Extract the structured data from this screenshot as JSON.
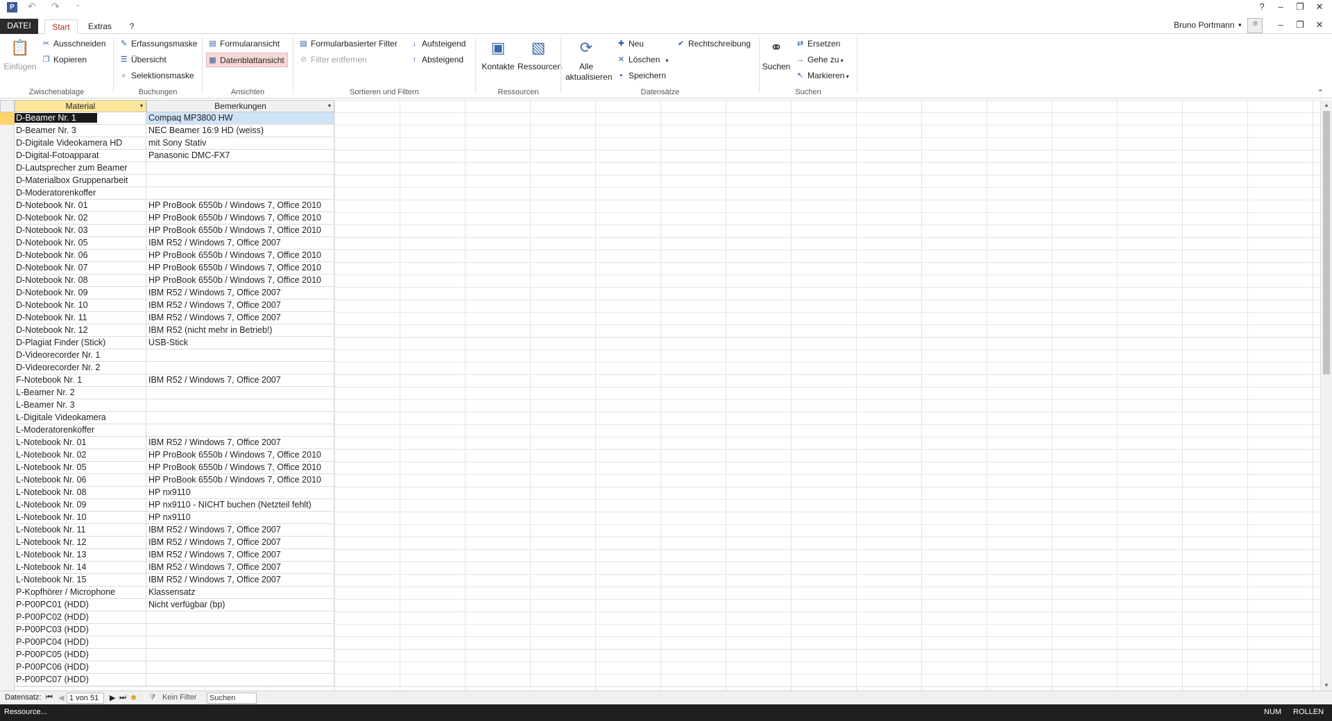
{
  "titlebar": {
    "undo": "↶",
    "redo": "↷",
    "more": "⌄",
    "help": "?",
    "min": "–",
    "restore": "❐",
    "close": "✕"
  },
  "tabs": {
    "file": "DATEI",
    "start": "Start",
    "extras": "Extras",
    "help": "?"
  },
  "user": {
    "name": "Bruno Portmann",
    "dropdown": "▾",
    "win_min": "–",
    "win_restore": "❐",
    "win_close": "✕"
  },
  "ribbon": {
    "clipboard": {
      "label": "Zwischenablage",
      "paste": "Einfügen",
      "cut": "Ausschneiden",
      "copy": "Kopieren"
    },
    "bookings": {
      "label": "Buchungen",
      "capture_mask": "Erfassungsmaske",
      "overview": "Übersicht",
      "selection_mask": "Selektionsmaske"
    },
    "views": {
      "label": "Ansichten",
      "form_view": "Formularansicht",
      "datasheet_view": "Datenblattansicht"
    },
    "sort_filter": {
      "label": "Sortieren und Filtern",
      "form_filter": "Formularbasierter Filter",
      "remove_filter": "Filter entfernen",
      "ascending": "Aufsteigend",
      "descending": "Absteigend"
    },
    "resources": {
      "label": "Ressourcen",
      "contacts": "Kontakte",
      "resources": "Ressourcen"
    },
    "records": {
      "label": "Datensätze",
      "refresh_all_1": "Alle",
      "refresh_all_2": "aktualisieren",
      "new": "Neu",
      "delete": "Löschen",
      "save": "Speichern",
      "spelling": "Rechtschreibung"
    },
    "find": {
      "label": "Suchen",
      "find": "Suchen",
      "replace": "Ersetzen",
      "goto": "Gehe zu",
      "select": "Markieren"
    }
  },
  "table": {
    "columns": [
      "Material",
      "Bemerkungen"
    ],
    "rows": [
      [
        "D-Beamer Nr. 1",
        "Compaq MP3800 HW"
      ],
      [
        "D-Beamer Nr. 3",
        "NEC Beamer 16:9 HD (weiss)"
      ],
      [
        "D-Digitale Videokamera HD",
        "mit Sony Stativ"
      ],
      [
        "D-Digital-Fotoapparat",
        "Panasonic DMC-FX7"
      ],
      [
        "D-Lautsprecher zum Beamer",
        ""
      ],
      [
        "D-Materialbox Gruppenarbeit",
        ""
      ],
      [
        "D-Moderatorenkoffer",
        ""
      ],
      [
        "D-Notebook Nr. 01",
        "HP ProBook 6550b / Windows 7, Office 2010"
      ],
      [
        "D-Notebook Nr. 02",
        "HP ProBook 6550b / Windows 7, Office 2010"
      ],
      [
        "D-Notebook Nr. 03",
        "HP ProBook 6550b / Windows 7, Office 2010"
      ],
      [
        "D-Notebook Nr. 05",
        "IBM R52 / Windows 7, Office 2007"
      ],
      [
        "D-Notebook Nr. 06",
        "HP ProBook 6550b / Windows 7, Office 2010"
      ],
      [
        "D-Notebook Nr. 07",
        "HP ProBook 6550b / Windows 7, Office 2010"
      ],
      [
        "D-Notebook Nr. 08",
        "HP ProBook 6550b / Windows 7, Office 2010"
      ],
      [
        "D-Notebook Nr. 09",
        "IBM R52 / Windows 7, Office 2007"
      ],
      [
        "D-Notebook Nr. 10",
        "IBM R52 / Windows 7, Office 2007"
      ],
      [
        "D-Notebook Nr. 11",
        "IBM R52 / Windows 7, Office 2007"
      ],
      [
        "D-Notebook Nr. 12",
        "IBM R52 (nicht mehr in Betrieb!)"
      ],
      [
        "D-Plagiat Finder (Stick)",
        "USB-Stick"
      ],
      [
        "D-Videorecorder Nr. 1",
        ""
      ],
      [
        "D-Videorecorder Nr. 2",
        ""
      ],
      [
        "F-Notebook Nr. 1",
        "IBM R52 / Windows 7, Office 2007"
      ],
      [
        "L-Beamer Nr. 2",
        ""
      ],
      [
        "L-Beamer Nr. 3",
        ""
      ],
      [
        "L-Digitale Videokamera",
        ""
      ],
      [
        "L-Moderatorenkoffer",
        ""
      ],
      [
        "L-Notebook Nr. 01",
        "IBM R52 / Windows 7, Office 2007"
      ],
      [
        "L-Notebook Nr. 02",
        "HP ProBook 6550b / Windows 7, Office 2010"
      ],
      [
        "L-Notebook Nr. 05",
        "HP ProBook 6550b / Windows 7, Office 2010"
      ],
      [
        "L-Notebook Nr. 06",
        "HP ProBook 6550b / Windows 7, Office 2010"
      ],
      [
        "L-Notebook Nr. 08",
        "HP nx9110"
      ],
      [
        "L-Notebook Nr. 09",
        "HP nx9110 - NICHT buchen (Netzteil fehlt)"
      ],
      [
        "L-Notebook Nr. 10",
        "HP nx9110"
      ],
      [
        "L-Notebook Nr. 11",
        "IBM R52 / Windows 7, Office 2007"
      ],
      [
        "L-Notebook Nr. 12",
        "IBM R52 / Windows 7, Office 2007"
      ],
      [
        "L-Notebook Nr. 13",
        "IBM R52 / Windows 7, Office 2007"
      ],
      [
        "L-Notebook Nr. 14",
        "IBM R52 / Windows 7, Office 2007"
      ],
      [
        "L-Notebook Nr. 15",
        "IBM R52 / Windows 7, Office 2007"
      ],
      [
        "P-Kopfhörer / Microphone",
        "Klassensatz"
      ],
      [
        "P-P00PC01 (HDD)",
        "Nicht verfügbar (bp)"
      ],
      [
        "P-P00PC02 (HDD)",
        ""
      ],
      [
        "P-P00PC03 (HDD)",
        ""
      ],
      [
        "P-P00PC04 (HDD)",
        ""
      ],
      [
        "P-P00PC05 (HDD)",
        ""
      ],
      [
        "P-P00PC06 (HDD)",
        ""
      ],
      [
        "P-P00PC07 (HDD)",
        ""
      ]
    ]
  },
  "navigation": {
    "label": "Datensatz:",
    "position": "1 von 51",
    "filter": "Kein Filter",
    "search_placeholder": "Suchen"
  },
  "statusbar": {
    "left": "Ressource...",
    "num": "NUM",
    "scroll": "ROLLEN"
  }
}
